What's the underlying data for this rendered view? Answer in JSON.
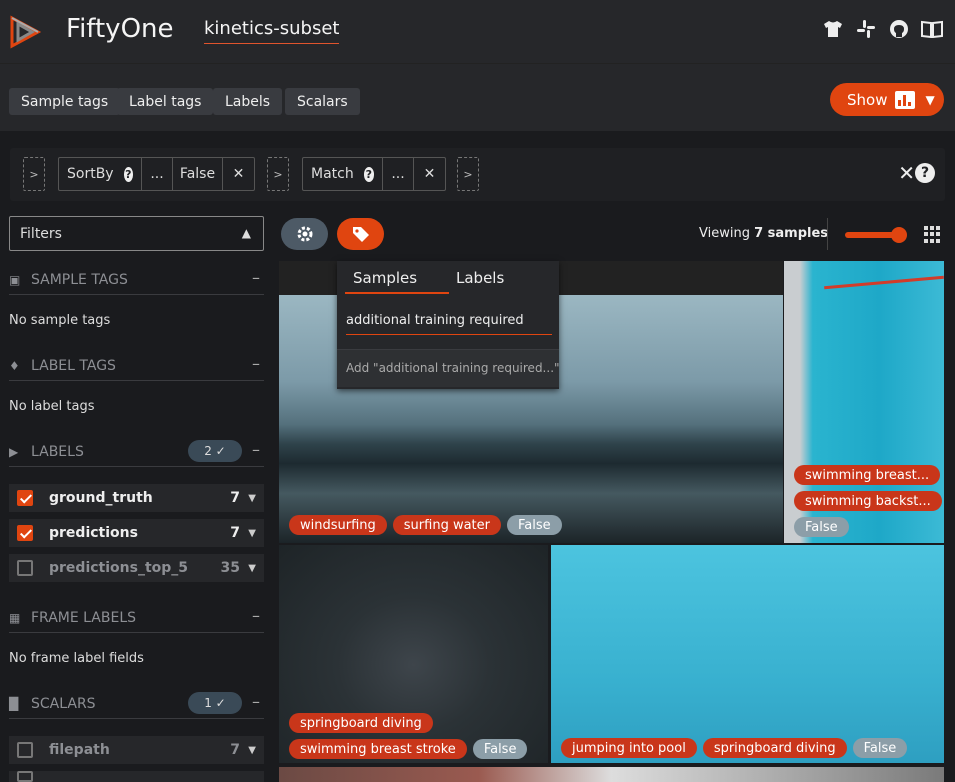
{
  "header": {
    "brand": "FiftyOne",
    "dataset": "kinetics-subset",
    "icons": [
      "tshirt-icon",
      "slack-icon",
      "github-icon",
      "book-icon"
    ]
  },
  "toolbar": {
    "buttons": [
      "Sample tags",
      "Label tags",
      "Labels",
      "Scalars"
    ],
    "show_label": "Show"
  },
  "view_bar": {
    "stages": [
      {
        "name": "SortBy",
        "params": [
          "...",
          "False"
        ]
      },
      {
        "name": "Match",
        "params": [
          "..."
        ]
      }
    ],
    "close_glyph": "✕",
    "help_glyph": "?"
  },
  "sidebar": {
    "filters_label": "Filters",
    "sample_tags": {
      "title": "SAMPLE TAGS",
      "empty": "No sample tags"
    },
    "label_tags": {
      "title": "LABEL TAGS",
      "empty": "No label tags"
    },
    "labels": {
      "title": "LABELS",
      "badge": "2 ✓",
      "items": [
        {
          "name": "ground_truth",
          "count": "7",
          "checked": true
        },
        {
          "name": "predictions",
          "count": "7",
          "checked": true
        },
        {
          "name": "predictions_top_5",
          "count": "35",
          "checked": false
        }
      ]
    },
    "frame_labels": {
      "title": "FRAME LABELS",
      "empty": "No frame label fields"
    },
    "scalars": {
      "title": "SCALARS",
      "badge": "1 ✓",
      "items": [
        {
          "name": "filepath",
          "count": "7",
          "checked": false
        }
      ]
    }
  },
  "grid": {
    "viewing_prefix": "Viewing ",
    "viewing_count": "7 samples",
    "zoom_level": 1.0,
    "tiles": [
      {
        "tags": [
          "windsurfing",
          "surfing water"
        ],
        "bool": "False"
      },
      {
        "tags": [
          "swimming breast...",
          "swimming backst..."
        ],
        "bool": "False"
      },
      {
        "tags": [
          "springboard diving",
          "swimming breast stroke"
        ],
        "bool": "False"
      },
      {
        "tags": [
          "jumping into pool",
          "springboard diving"
        ],
        "bool": "False"
      }
    ]
  },
  "tag_popup": {
    "tabs": [
      "Samples",
      "Labels"
    ],
    "input_value": "additional training required",
    "add_option": "Add \"additional training required...\""
  },
  "colors": {
    "accent": "#e04510",
    "tag": "#c9361a",
    "bool_tag": "#8c9ea8"
  }
}
